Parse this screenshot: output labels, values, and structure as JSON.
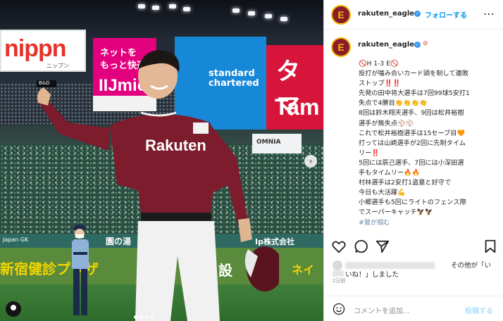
{
  "header": {
    "username": "rakuten_eagles",
    "follow_label": "フォローする",
    "more_icon": "more-horizontal-icon"
  },
  "photo": {
    "ad_nippn": "nippn",
    "ad_nippn_small": "ニップン",
    "ad_iij_line1": "ネットを",
    "ad_iij_line2": "もっと快適に",
    "ad_iij_line3": "IIJmio",
    "ad_scb": "standard chartered",
    "ad_tama_top": "タマ",
    "ad_tama_bottom": "Tam",
    "ad_omnia": "OMNIA",
    "score_sign": "B&D",
    "wall_text_1": "Japan GK",
    "wall_text_2": "園の湯",
    "wall_text_3": "Ip株式会社",
    "wall_text_4": "新宿健診プラザ",
    "wall_text_5": "設",
    "wall_text_6": "ネイ",
    "jersey_text": "Rakuten"
  },
  "caption": {
    "username": "rakuten_eagles",
    "lines": [
      "🚫H 1-3 E🚫",
      "投打が噛み合いカード頭を制して連敗",
      "ストップ‼️‼️",
      "先発の田中将大選手は7回99球5安打1",
      "失点で4勝目👏👏👏👏",
      "8回は鈴木翔天選手、9回は松井裕樹",
      "選手が無失点⚾⚾",
      "これで松井裕樹選手は15セーブ目🧡",
      "打っては山崎選手が2回に先制タイム",
      "リー‼️",
      "5回には辰己選手、7回には小深田選",
      "手もタイムリー🔥🔥",
      "村林選手は2安打1盗塁と好守で",
      "今日も大活躍💪",
      "小郷選手も5回にライトのフェンス際",
      "でスーパーキャッチ🦅🦅"
    ],
    "tag_line": "#鷲が掴む"
  },
  "likes": {
    "text_suffix": "その他が「い",
    "text_line2": "いね！」しました"
  },
  "date": "2日前",
  "comment": {
    "placeholder": "コメントを追加...",
    "post_label": "投稿する"
  },
  "colors": {
    "accent": "#0095f6",
    "eagles_crimson": "#8a1b2b",
    "eagles_gold": "#f2b800"
  }
}
